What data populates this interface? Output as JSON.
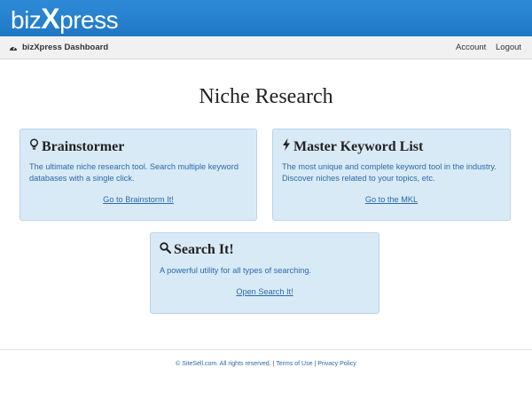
{
  "brand": {
    "logo_prefix": "biz",
    "logo_x": "X",
    "logo_suffix": "press"
  },
  "navbar": {
    "dashboard_label": "bizXpress Dashboard",
    "account_label": "Account",
    "logout_label": "Logout"
  },
  "page": {
    "title": "Niche Research"
  },
  "cards": [
    {
      "title": "Brainstormer",
      "icon": "lightbulb-icon",
      "description": "The ultimate niche research tool. Search multiple keyword databases with a single click.",
      "link": "Go to Brainstorm It!"
    },
    {
      "title": "Master Keyword List",
      "icon": "bolt-icon",
      "description": "The most unique and complete keyword tool in the industry. Discover niches related to your topics, etc.",
      "link": "Go to the MKL"
    },
    {
      "title": "Search It!",
      "icon": "search-icon",
      "description": "A powerful utility for all types of searching.",
      "link": "Open Search It!"
    }
  ],
  "footer": {
    "copyright": "© SiteSell.com. All rights reserved.",
    "separator": "|",
    "terms": "Terms of Use",
    "privacy": "Privacy Policy"
  },
  "colors": {
    "brand_blue": "#1f78c6",
    "card_bg": "#d9eaf7",
    "link_blue": "#2a6aa6"
  }
}
